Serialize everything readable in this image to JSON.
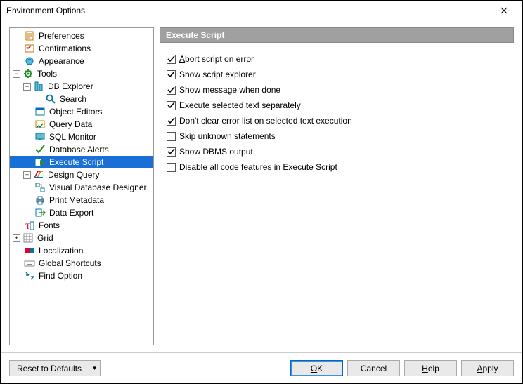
{
  "window": {
    "title": "Environment Options"
  },
  "panel": {
    "header": "Execute Script"
  },
  "tree": {
    "preferences": "Preferences",
    "confirmations": "Confirmations",
    "appearance": "Appearance",
    "tools": "Tools",
    "db_explorer": "DB Explorer",
    "search": "Search",
    "object_editors": "Object Editors",
    "query_data": "Query Data",
    "sql_monitor": "SQL Monitor",
    "database_alerts": "Database Alerts",
    "execute_script": "Execute Script",
    "design_query": "Design Query",
    "visual_db_designer": "Visual Database Designer",
    "print_metadata": "Print Metadata",
    "data_export": "Data Export",
    "fonts": "Fonts",
    "grid": "Grid",
    "localization": "Localization",
    "global_shortcuts": "Global Shortcuts",
    "find_option": "Find Option"
  },
  "options": {
    "abort_on_error": {
      "label_pre": "A",
      "label_post": "bort script on error",
      "checked": true
    },
    "show_explorer": {
      "label": "Show script explorer",
      "checked": true
    },
    "show_done_msg": {
      "label": "Show message when done",
      "checked": true
    },
    "exec_sel_sep": {
      "label": "Execute selected text separately",
      "checked": true
    },
    "dont_clear_errors": {
      "label": "Don't clear error list on selected text execution",
      "checked": true
    },
    "skip_unknown": {
      "label": "Skip unknown statements",
      "checked": false
    },
    "show_dbms": {
      "label": "Show DBMS output",
      "checked": true
    },
    "disable_code_feat": {
      "label": "Disable all code features in Execute Script",
      "checked": false
    }
  },
  "buttons": {
    "reset": "Reset to Defaults",
    "ok_pre": "O",
    "ok_post": "K",
    "cancel": "Cancel",
    "help_pre": "H",
    "help_post": "elp",
    "apply_pre": "A",
    "apply_post": "pply"
  }
}
